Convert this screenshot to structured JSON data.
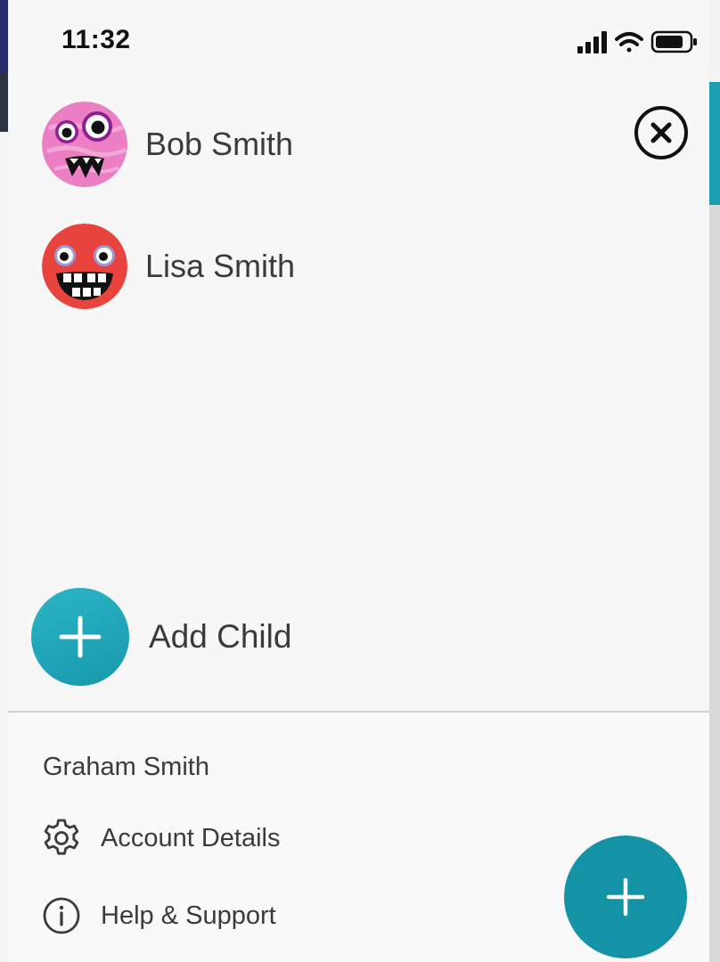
{
  "status_bar": {
    "time": "11:32"
  },
  "children": [
    {
      "name": "Bob Smith",
      "avatar": "pink-monster-avatar"
    },
    {
      "name": "Lisa Smith",
      "avatar": "red-monster-avatar"
    }
  ],
  "add_child": {
    "label": "Add Child",
    "icon": "plus-icon"
  },
  "account": {
    "user_name": "Graham Smith",
    "menu": [
      {
        "label": "Account Details",
        "icon": "gear-icon"
      },
      {
        "label": "Help & Support",
        "icon": "info-icon"
      }
    ]
  },
  "colors": {
    "accent": "#1493a7",
    "accent_light": "#2bb5c6"
  }
}
